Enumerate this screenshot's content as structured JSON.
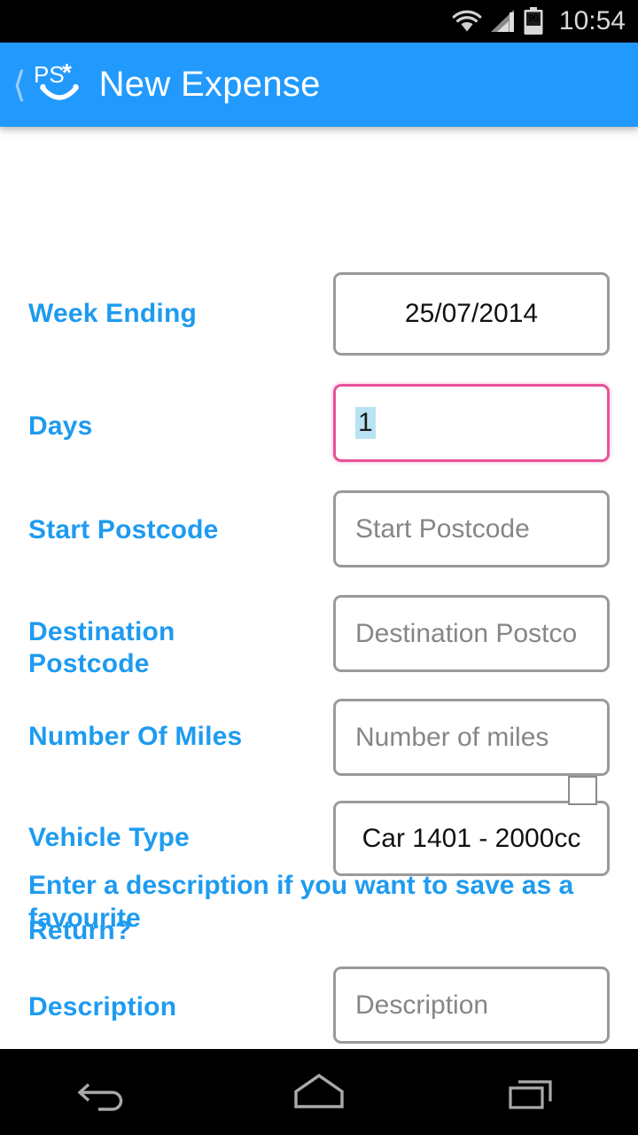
{
  "status_bar": {
    "wifi_icon": "wifi-icon",
    "signal_icon": "signal-bars-icon",
    "battery_icon": "battery-icon",
    "battery_level": "90",
    "time": "10:54"
  },
  "header": {
    "back_icon": "back-chevron-icon",
    "logo_text": "PS*",
    "logo_name": "ps-smile-logo",
    "title": "New Expense",
    "bar_color": "#229afd"
  },
  "form": {
    "fields": [
      {
        "label": "Week Ending",
        "value": "25/07/2014",
        "placeholder": "",
        "align": "center",
        "focused": false
      },
      {
        "label": "Days",
        "value": "1",
        "placeholder": "",
        "align": "left",
        "focused": true,
        "selected": true
      },
      {
        "label": "Start Postcode",
        "value": "",
        "placeholder": "Start Postcode",
        "align": "left",
        "focused": false
      },
      {
        "label": "Destination Postcode",
        "value": "",
        "placeholder": "Destination Postco",
        "align": "left",
        "focused": false
      },
      {
        "label": "Number Of Miles",
        "value": "",
        "placeholder": "Number of miles",
        "align": "left",
        "focused": false
      },
      {
        "label": "Vehicle Type",
        "value": "Car 1401 - 2000cc",
        "placeholder": "",
        "align": "center",
        "focused": false
      }
    ],
    "return_row": {
      "label": "Return?",
      "checkbox_name": "return-checkbox",
      "checked": false
    },
    "favourite_note": "Enter a description if you want to save as a favourite",
    "description_row": {
      "label": "Description",
      "value": "",
      "placeholder": "Description"
    }
  },
  "nav_bar": {
    "back": "back-arrow-icon",
    "home": "home-icon",
    "recents": "recent-apps-icon"
  },
  "colors": {
    "accent_blue": "#1e9bf0",
    "header_blue": "#229afd",
    "focus_pink": "#e8529b",
    "field_border": "#9a9a9a",
    "placeholder_gray": "#868686",
    "selection_highlight": "#b9e2f2"
  }
}
